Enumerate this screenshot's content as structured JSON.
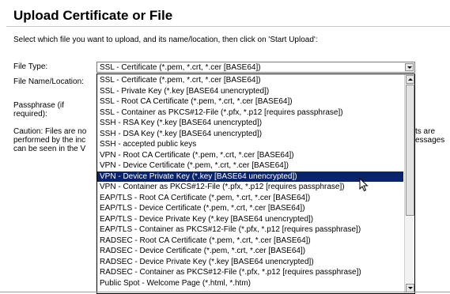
{
  "page": {
    "title": "Upload Certificate or File",
    "instruction": "Select which file you want to upload, and its name/location, then click on 'Start Upload':"
  },
  "form": {
    "file_type_label": "File Type:",
    "file_name_label": "File Name/Location:",
    "passphrase_label": "Passphrase (if required):",
    "caution_left_lines": [
      "Caution: Files are no",
      "performed by the inc",
      "can be seen in the V"
    ],
    "caution_right_lines": [
      "ts are",
      "essages",
      ""
    ],
    "selected_value": "SSL - Certificate (*.pem, *.crt, *.cer [BASE64])"
  },
  "dropdown": {
    "options": [
      "SSL - Certificate (*.pem, *.crt, *.cer [BASE64])",
      "SSL - Private Key (*.key [BASE64 unencrypted])",
      "SSL - Root CA Certificate (*.pem, *.crt, *.cer [BASE64])",
      "SSL - Container as PKCS#12-File (*.pfx, *.p12 [requires passphrase])",
      "SSH - RSA Key (*.key [BASE64 unencrypted])",
      "SSH - DSA Key (*.key [BASE64 unencrypted])",
      "SSH - accepted public keys",
      "VPN - Root CA Certificate (*.pem, *.crt, *.cer [BASE64])",
      "VPN - Device Certificate (*.pem, *.crt, *.cer [BASE64])",
      "VPN - Device Private Key (*.key [BASE64 unencrypted])",
      "VPN - Container as PKCS#12-File (*.pfx, *.p12 [requires passphrase])",
      "EAP/TLS - Root CA Certificate (*.pem, *.crt, *.cer [BASE64])",
      "EAP/TLS - Device Certificate (*.pem, *.crt, *.cer [BASE64])",
      "EAP/TLS - Device Private Key (*.key [BASE64 unencrypted])",
      "EAP/TLS - Container as PKCS#12-File (*.pfx, *.p12 [requires passphrase])",
      "RADSEC - Root CA Certificate (*.pem, *.crt, *.cer [BASE64])",
      "RADSEC - Device Certificate (*.pem, *.crt, *.cer [BASE64])",
      "RADSEC - Device Private Key (*.key [BASE64 unencrypted])",
      "RADSEC - Container as PKCS#12-File (*.pfx, *.p12 [requires passphrase])",
      "Public Spot - Welcome Page (*.html, *.htm)"
    ],
    "highlighted_index": 9,
    "highlight_color": "#0a246a"
  },
  "icons": {
    "select_arrow": "chevron-down-icon",
    "scroll_up": "scroll-up-arrow-icon",
    "scroll_down": "scroll-down-arrow-icon",
    "pointer": "mouse-cursor-icon"
  }
}
